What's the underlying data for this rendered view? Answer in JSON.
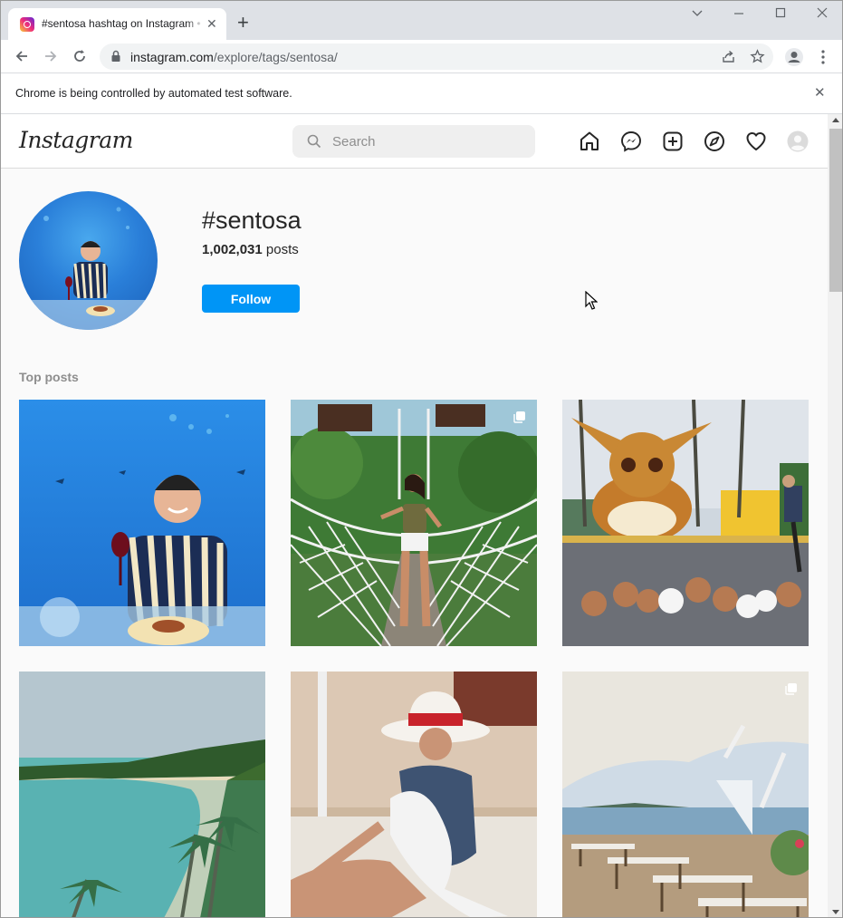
{
  "browser": {
    "tab_title": "#sentosa hashtag on Instagram • Photos and Videos",
    "tab_close": "✕",
    "new_tab": "+",
    "url_host": "instagram.com",
    "url_path": "/explore/tags/sentosa/",
    "infobar_text": "Chrome is being controlled by automated test software.",
    "infobar_close": "✕"
  },
  "instagram": {
    "logo": "Instagram",
    "search_placeholder": "Search",
    "nav_icons": [
      "home-icon",
      "messenger-icon",
      "new-post-icon",
      "explore-icon",
      "activity-heart-icon",
      "profile-avatar-icon"
    ]
  },
  "hashtag": {
    "name": "#sentosa",
    "post_count": "1,002,031",
    "post_label": "posts",
    "follow_label": "Follow"
  },
  "top_posts": {
    "label": "Top posts",
    "items": [
      {
        "subject": "man in striped shirt at underwater aquarium dinner",
        "multi": false
      },
      {
        "subject": "woman on rope suspension bridge",
        "multi": true
      },
      {
        "subject": "giant Eevee statue with poodles",
        "multi": false
      },
      {
        "subject": "beach lagoon with palm trees",
        "multi": false
      },
      {
        "subject": "woman in white hat and blue swimsuit",
        "multi": false
      },
      {
        "subject": "outdoor restaurant terrace overlooking sea",
        "multi": true
      }
    ]
  },
  "colors": {
    "accent": "#0095f6",
    "page_bg": "#fafafa",
    "chrome_frame": "#dee1e6"
  }
}
